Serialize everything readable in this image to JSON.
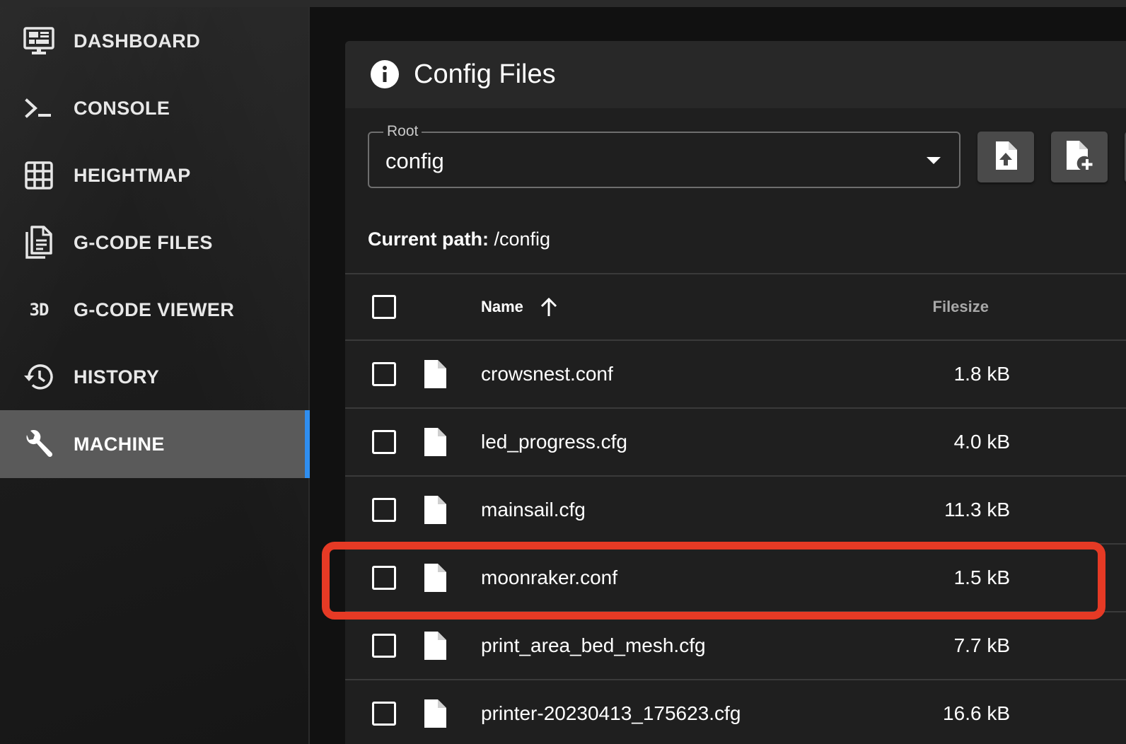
{
  "sidebar": {
    "items": [
      {
        "label": "DASHBOARD",
        "icon": "monitor-dashboard-icon",
        "active": false
      },
      {
        "label": "CONSOLE",
        "icon": "console-icon",
        "active": false
      },
      {
        "label": "HEIGHTMAP",
        "icon": "grid-icon",
        "active": false
      },
      {
        "label": "G-CODE FILES",
        "icon": "file-document-multiple-icon",
        "active": false
      },
      {
        "label": "G-CODE VIEWER",
        "icon": "video-3d-icon",
        "icon_text": "3D",
        "active": false
      },
      {
        "label": "HISTORY",
        "icon": "history-icon",
        "active": false
      },
      {
        "label": "MACHINE",
        "icon": "wrench-icon",
        "active": true
      }
    ],
    "active_accent": "#2f8ef0"
  },
  "card": {
    "title": "Config Files",
    "title_icon": "information-icon",
    "root_select": {
      "legend": "Root",
      "value": "config"
    },
    "buttons": {
      "upload_icon": "file-upload-icon",
      "new_file_icon": "file-plus-icon"
    },
    "current_path": {
      "label": "Current path:",
      "value": "/config"
    }
  },
  "table": {
    "headers": {
      "name": "Name",
      "filesize": "Filesize",
      "sort_icon": "arrow-up-icon"
    },
    "rows": [
      {
        "name": "crowsnest.conf",
        "size": "1.8 kB"
      },
      {
        "name": "led_progress.cfg",
        "size": "4.0 kB"
      },
      {
        "name": "mainsail.cfg",
        "size": "11.3 kB"
      },
      {
        "name": "moonraker.conf",
        "size": "1.5 kB"
      },
      {
        "name": "print_area_bed_mesh.cfg",
        "size": "7.7 kB"
      },
      {
        "name": "printer-20230413_175623.cfg",
        "size": "16.6 kB"
      }
    ]
  },
  "annotation": {
    "highlight_color": "#e63a25",
    "highlighted_row": "moonraker.conf"
  }
}
